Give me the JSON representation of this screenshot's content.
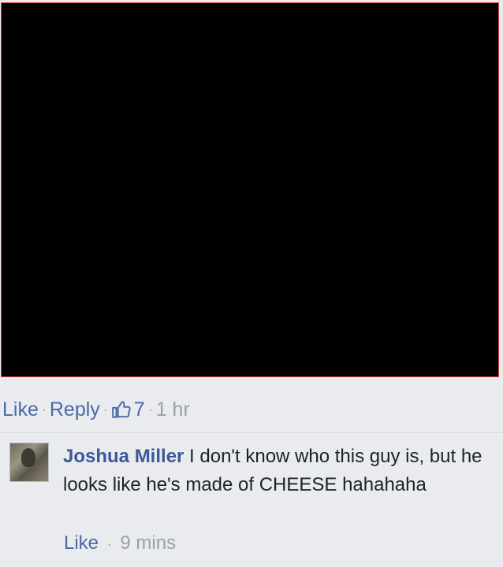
{
  "post": {
    "actions": {
      "like": "Like",
      "reply": "Reply",
      "like_count": "7",
      "time": "1 hr"
    }
  },
  "reply": {
    "author": "Joshua Miller",
    "text": "I don't know who this guy is, but he looks like he's made of CHEESE hahahaha",
    "like": "Like",
    "time": "9 mins"
  },
  "colors": {
    "link": "#4a6aa5",
    "author": "#3b5998",
    "muted": "#9aa0ab",
    "background": "#e9ebef",
    "media_border": "#d9433f"
  },
  "icons": {
    "like_count_icon": "thumbs-up-icon"
  }
}
